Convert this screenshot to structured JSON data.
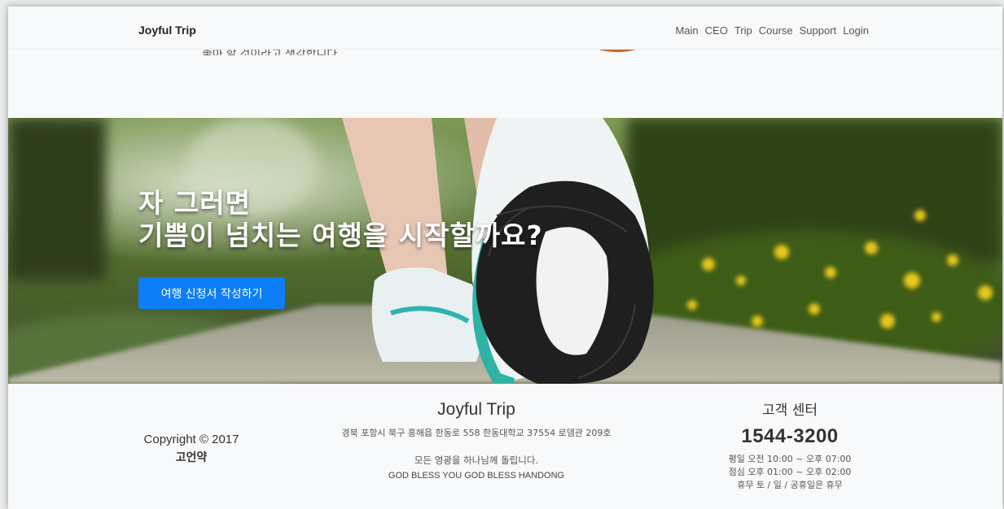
{
  "navbar": {
    "brand": "Joyful Trip",
    "links": [
      "Main",
      "CEO",
      "Trip",
      "Course",
      "Support",
      "Login"
    ]
  },
  "top_section": {
    "scrolled_text": "좋아 할 것이라고 생각합니다."
  },
  "hero": {
    "line1": "자 그러면",
    "line2": "기쁨이 넘치는 여행을 시작할까요?",
    "button_label": "여행 신청서 작성하기"
  },
  "footer": {
    "copyright": "Copyright © 2017",
    "author": "고언약",
    "brand": "Joyful Trip",
    "address": "경북 포항시 북구 흥해읍 한동로 558 한동대학교 37554 로뎀관 209호",
    "dedication": "모든 영광을 하나님께 돌립니다.",
    "motto": "GOD BLESS YOU GOD BLESS HANDONG",
    "support_title": "고객 센터",
    "phone": "1544-3200",
    "hours": [
      "평일 오전 10:00 ~ 오후 07:00",
      "점심 오후 01:00 ~ 오후 02:00",
      "휴무 토 / 일 / 공휴일은 휴무"
    ]
  },
  "colors": {
    "accent_button": "#0d7ef5",
    "navbar_bg": "#f8f9fa",
    "orange_circle": "#f48b20"
  }
}
